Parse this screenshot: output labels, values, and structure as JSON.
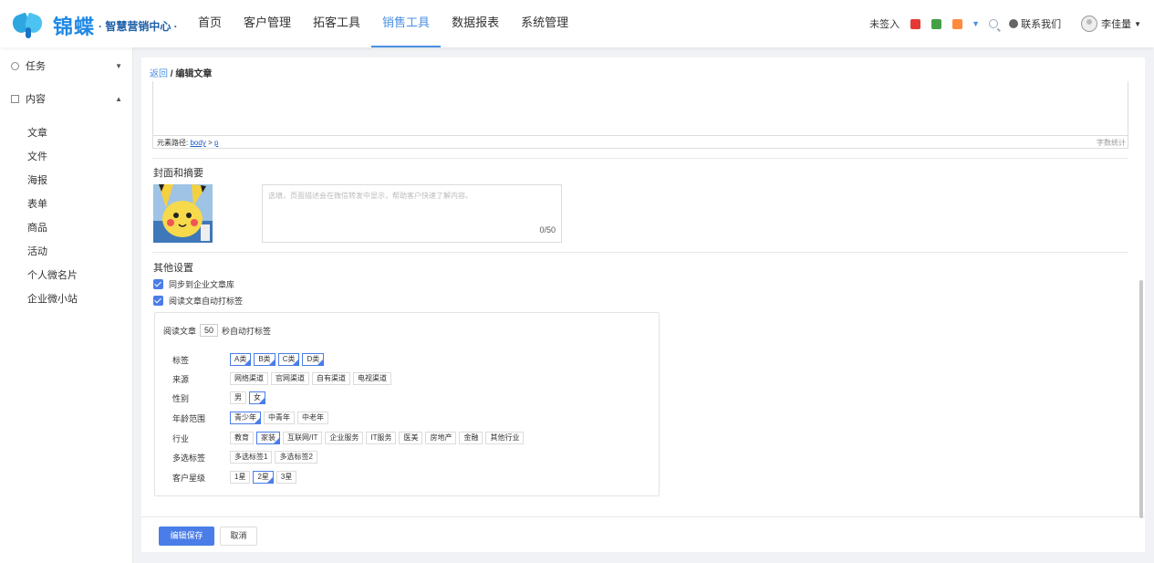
{
  "logo": {
    "text": "锦蝶",
    "subtitle": "· 智慧营销中心 ·"
  },
  "nav": {
    "items": [
      "首页",
      "客户管理",
      "拓客工具",
      "销售工具",
      "数据报表",
      "系统管理"
    ],
    "active": "销售工具"
  },
  "topbar": {
    "signin_status": "未签入",
    "contact": "联系我们",
    "user_name": "李佳量"
  },
  "sidebar": {
    "groups": [
      {
        "label": "任务",
        "icon": "clock-icon",
        "expanded": false
      },
      {
        "label": "内容",
        "icon": "content-icon",
        "expanded": true
      }
    ],
    "items": [
      "文章",
      "文件",
      "海报",
      "表单",
      "商品",
      "活动",
      "个人微名片",
      "企业微小站"
    ]
  },
  "breadcrumb": {
    "back": "返回",
    "separator": "/",
    "current": "编辑文章"
  },
  "editor": {
    "path_label": "元素路径:",
    "path_body": "body",
    "path_sep": ">",
    "path_p": "p",
    "word_count": "字数统计"
  },
  "cover_section": {
    "title": "封面和摘要",
    "summary_placeholder": "选填，页面描述会在微信转发中显示，帮助客户快速了解内容。",
    "summary_count": "0/50"
  },
  "other_settings": {
    "title": "其他设置",
    "sync_label": "同步到企业文章库",
    "auto_tag_label": "阅读文章自动打标签",
    "read_prefix": "阅读文章",
    "read_seconds": "50",
    "read_suffix": "秒自动打标签"
  },
  "tag_rows": [
    {
      "label": "标签",
      "options": [
        "A类",
        "B类",
        "C类",
        "D类"
      ],
      "selected": [
        0,
        1,
        2,
        3
      ]
    },
    {
      "label": "来源",
      "options": [
        "网络渠道",
        "官网渠道",
        "自有渠道",
        "电视渠道"
      ],
      "selected": []
    },
    {
      "label": "性别",
      "options": [
        "男",
        "女"
      ],
      "selected": [
        1
      ]
    },
    {
      "label": "年龄范围",
      "options": [
        "青少年",
        "中青年",
        "中老年"
      ],
      "selected": [
        0
      ]
    },
    {
      "label": "行业",
      "options": [
        "教育",
        "家装",
        "互联网/IT",
        "企业服务",
        "IT服务",
        "医美",
        "房地产",
        "金融",
        "其他行业"
      ],
      "selected": [
        1
      ]
    },
    {
      "label": "多选标签",
      "options": [
        "多选标签1",
        "多选标签2"
      ],
      "selected": []
    },
    {
      "label": "客户星级",
      "options": [
        "1星",
        "2星",
        "3星"
      ],
      "selected": [
        1
      ]
    }
  ],
  "actions": {
    "save": "编辑保存",
    "cancel": "取消"
  },
  "colors": {
    "accent": "#4a7de8",
    "nav_active": "#4a90e2"
  }
}
